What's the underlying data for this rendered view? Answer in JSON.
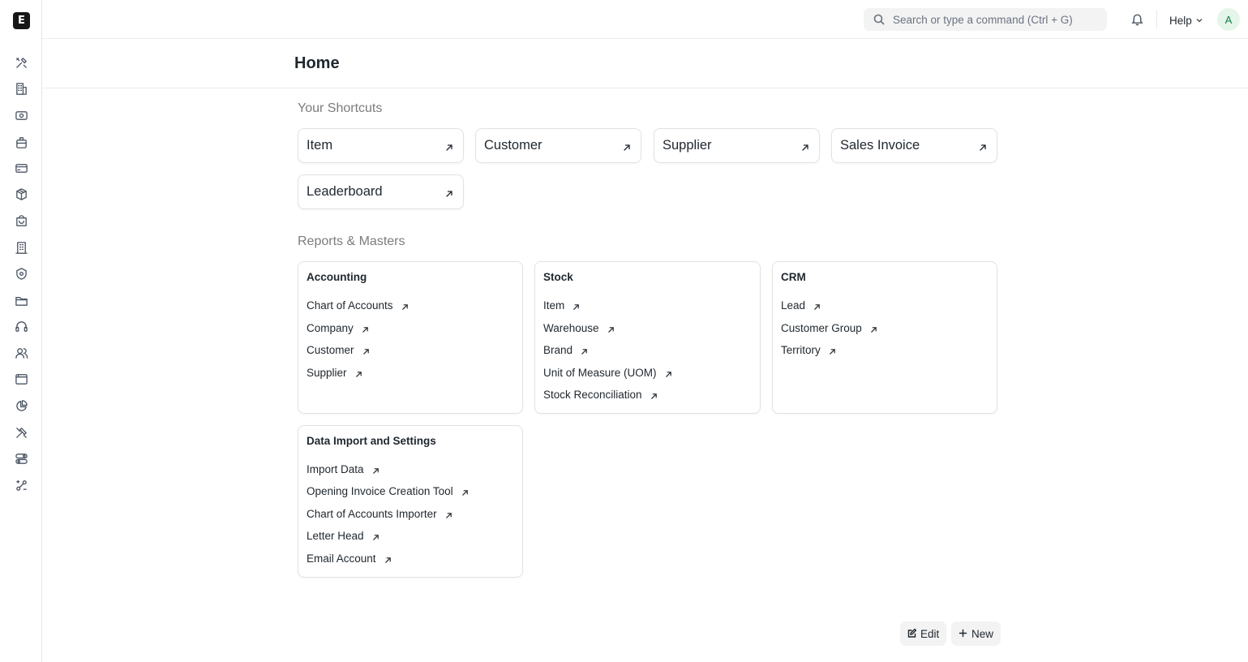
{
  "brand": {
    "logo_letter": "E"
  },
  "sidebar": {
    "icons": [
      "tools-icon",
      "building-icon",
      "eye-icon",
      "briefcase-icon",
      "card-icon",
      "box-icon",
      "shopping-bag-icon",
      "office-icon",
      "shield-icon",
      "folder-icon",
      "headset-icon",
      "users-icon",
      "browser-icon",
      "pie-chart-icon",
      "hammer-icon",
      "toggle-icon",
      "integration-icon"
    ]
  },
  "navbar": {
    "search_placeholder": "Search or type a command (Ctrl + G)",
    "help_label": "Help",
    "avatar_initial": "A"
  },
  "page": {
    "title": "Home"
  },
  "shortcuts": {
    "title": "Your Shortcuts",
    "items": [
      {
        "label": "Item"
      },
      {
        "label": "Customer"
      },
      {
        "label": "Supplier"
      },
      {
        "label": "Sales Invoice"
      },
      {
        "label": "Leaderboard"
      }
    ]
  },
  "reports": {
    "title": "Reports & Masters",
    "cards": [
      {
        "title": "Accounting",
        "links": [
          "Chart of Accounts",
          "Company",
          "Customer",
          "Supplier"
        ]
      },
      {
        "title": "Stock",
        "links": [
          "Item",
          "Warehouse",
          "Brand",
          "Unit of Measure (UOM)",
          "Stock Reconciliation"
        ]
      },
      {
        "title": "CRM",
        "links": [
          "Lead",
          "Customer Group",
          "Territory"
        ]
      },
      {
        "title": "Data Import and Settings",
        "links": [
          "Import Data",
          "Opening Invoice Creation Tool",
          "Chart of Accounts Importer",
          "Letter Head",
          "Email Account"
        ]
      }
    ]
  },
  "actions": {
    "edit_label": "Edit",
    "new_label": "New"
  }
}
